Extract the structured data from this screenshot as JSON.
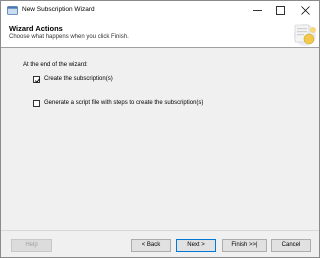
{
  "window": {
    "title": "New Subscription Wizard"
  },
  "header": {
    "title": "Wizard Actions",
    "subtitle": "Choose what happens when you click Finish."
  },
  "options": {
    "group_label": "At the end of the wizard:",
    "items": [
      {
        "label": "Create the subscription(s)",
        "checked": true
      },
      {
        "label": "Generate a script file with steps to create the subscription(s)",
        "checked": false
      }
    ]
  },
  "buttons": {
    "help": "Help",
    "back": "< Back",
    "next": "Next >",
    "finish": "Finish >>|",
    "cancel": "Cancel"
  },
  "colors": {
    "accent": "#0078d7",
    "panel": "#f0f0f0",
    "header_bg": "#ffffff"
  }
}
